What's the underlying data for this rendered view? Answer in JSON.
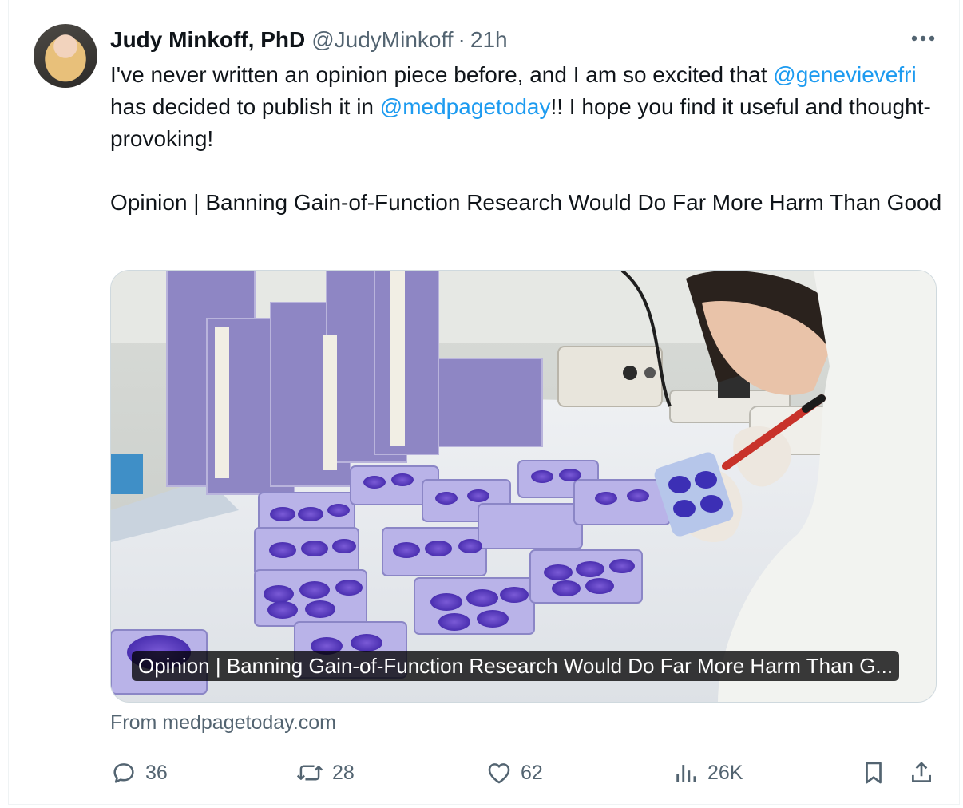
{
  "author": {
    "display_name": "Judy Minkoff, PhD",
    "handle": "@JudyMinkoff",
    "separator": "·",
    "time": "21h"
  },
  "tweet": {
    "line1_prefix": "I've never written an opinion piece before, and I am so excited that ",
    "mention1": "@genevievefri",
    "line1_middle": " has decided to publish it in ",
    "mention2": "@medpagetoday",
    "line1_suffix": "!! I hope you find it useful and thought-provoking!",
    "article_line": "Opinion | Banning Gain-of-Function Research Would Do Far More Harm Than Good"
  },
  "card": {
    "title": "Opinion | Banning Gain-of-Function Research Would Do Far More Harm Than G...",
    "source": "From medpagetoday.com"
  },
  "actions": {
    "replies": "36",
    "reposts": "28",
    "likes": "62",
    "views": "26K"
  },
  "colors": {
    "link": "#1d9bf0",
    "secondary_text": "#536471",
    "primary_text": "#0f1419",
    "border": "#cfd9de"
  },
  "icons": [
    "avatar",
    "more-icon",
    "reply-icon",
    "repost-icon",
    "like-icon",
    "views-icon",
    "bookmark-icon",
    "share-icon"
  ]
}
